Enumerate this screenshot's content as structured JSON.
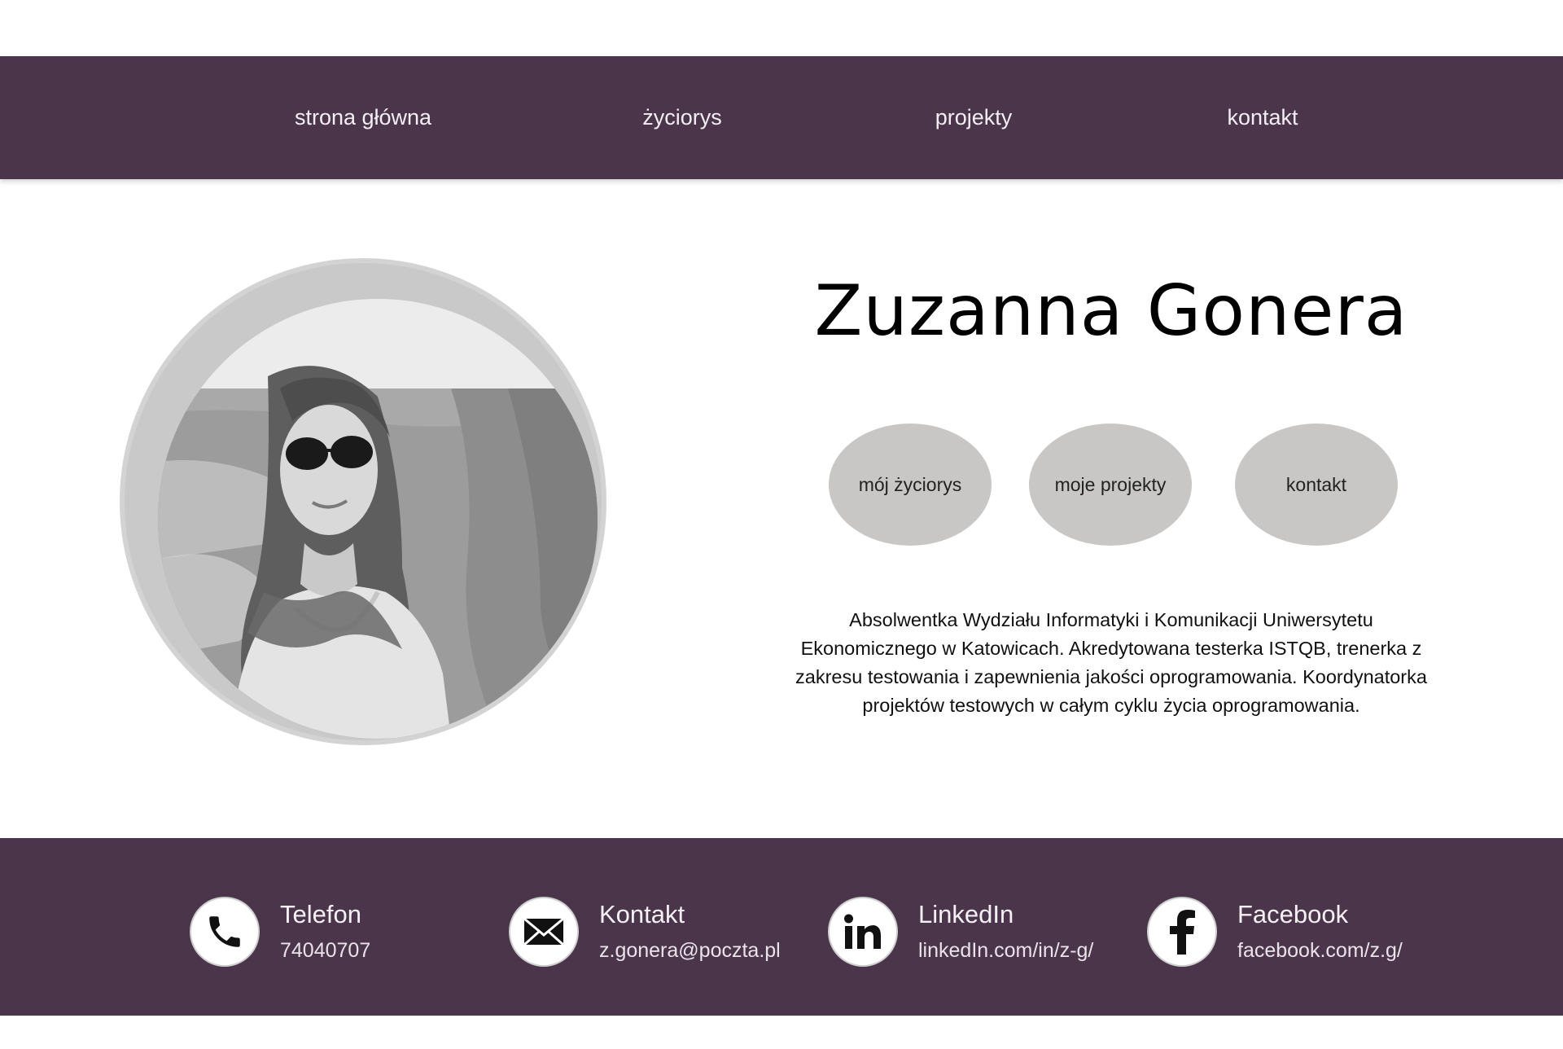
{
  "nav": {
    "items": [
      {
        "label": "strona główna"
      },
      {
        "label": "życiorys"
      },
      {
        "label": "projekty"
      },
      {
        "label": "kontakt"
      }
    ]
  },
  "hero": {
    "name": "Zuzanna Gonera",
    "buttons": [
      {
        "label": "mój życiorys"
      },
      {
        "label": "moje projekty"
      },
      {
        "label": "kontakt"
      }
    ],
    "bio": "Absolwentka Wydziału Informatyki i Komunikacji Uniwersytetu Ekonomicznego w Katowicach. Akredytowana testerka ISTQB, trenerka z zakresu testowania i zapewnienia jakości oprogramowania. Koordynatorka projektów testowych w całym cyklu życia oprogramowania."
  },
  "footer": {
    "contacts": [
      {
        "icon": "phone-icon",
        "title": "Telefon",
        "value": "74040707"
      },
      {
        "icon": "envelope-icon",
        "title": "Kontakt",
        "value": "z.gonera@poczta.pl"
      },
      {
        "icon": "linkedin-icon",
        "title": "LinkedIn",
        "value": "linkedIn.com/in/z-g/"
      },
      {
        "icon": "facebook-icon",
        "title": "Facebook",
        "value": "facebook.com/z.g/"
      }
    ]
  },
  "colors": {
    "brand": "#4b354b",
    "pill": "#c8c7c5",
    "photo_ring": "#c9c9c9"
  }
}
